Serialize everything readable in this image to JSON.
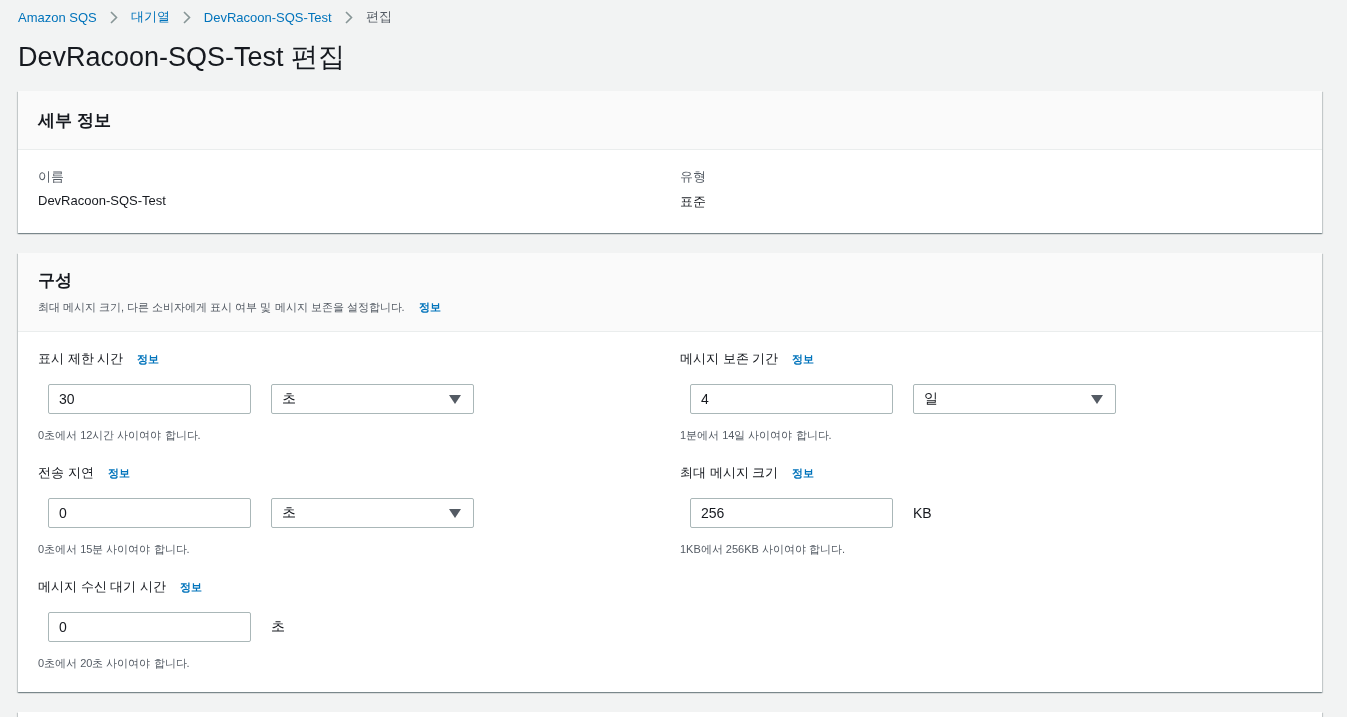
{
  "breadcrumb": [
    {
      "label": "Amazon SQS",
      "kind": "link"
    },
    {
      "label": "대기열",
      "kind": "link"
    },
    {
      "label": "DevRacoon-SQS-Test",
      "kind": "link"
    },
    {
      "label": "편집",
      "kind": "current"
    }
  ],
  "title": "DevRacoon-SQS-Test 편집",
  "details": {
    "title": "세부 정보",
    "fields": [
      {
        "label": "이름",
        "value": "DevRacoon-SQS-Test"
      },
      {
        "label": "유형",
        "value": "표준"
      }
    ]
  },
  "configuration": {
    "title": "구성",
    "description": "최대 메시지 크기, 다른 소비자에게 표시 여부 및 메시지 보존을 설정합니다.",
    "info": "정보",
    "columns": [
      [
        {
          "label": "표시 제한 시간",
          "info": "정보",
          "value": "30",
          "unit": "초",
          "kind": "select",
          "hint": "0초에서 12시간 사이여야 합니다."
        },
        {
          "label": "전송 지연",
          "info": "정보",
          "value": "0",
          "unit": "초",
          "kind": "select",
          "hint": "0초에서 15분 사이여야 합니다."
        },
        {
          "label": "메시지 수신 대기 시간",
          "info": "정보",
          "value": "0",
          "unit": "초",
          "kind": "text",
          "hint": "0초에서 20초 사이여야 합니다."
        }
      ],
      [
        {
          "label": "메시지 보존 기간",
          "info": "정보",
          "value": "4",
          "unit": "일",
          "kind": "select",
          "hint": "1분에서 14일 사이여야 합니다."
        },
        {
          "label": "최대 메시지 크기",
          "info": "정보",
          "value": "256",
          "unit": "KB",
          "kind": "text",
          "hint": "1KB에서 256KB 사이여야 합니다."
        }
      ]
    ]
  }
}
